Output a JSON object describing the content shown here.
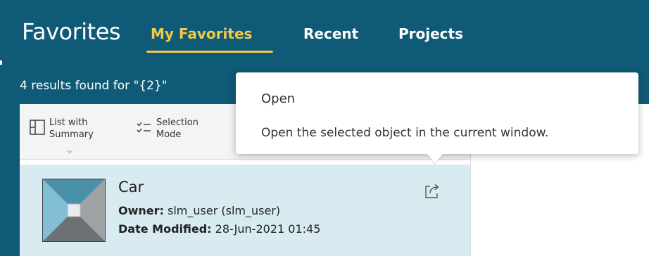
{
  "header": {
    "title": "Favorites",
    "tabs": [
      {
        "label": "My Favorites",
        "active": true
      },
      {
        "label": "Recent",
        "active": false
      },
      {
        "label": "Projects",
        "active": false
      }
    ],
    "accent_color": "#f2c94c",
    "background_color": "#0f5a76"
  },
  "results": {
    "text": "4 results found for \"{2}\""
  },
  "toolbar": {
    "view_mode": {
      "line1": "List with",
      "line2": "Summary",
      "icon": "list-with-summary-icon"
    },
    "selection_mode": {
      "line1": "Selection",
      "line2": "Mode",
      "icon": "selection-mode-icon"
    }
  },
  "items": [
    {
      "title": "Car",
      "owner_label": "Owner:",
      "owner_value": "slm_user (slm_user)",
      "date_label": "Date Modified:",
      "date_value": "28-Jun-2021 01:45",
      "icon": "share-icon"
    }
  ],
  "tooltip": {
    "title": "Open",
    "description": "Open the selected object in the current window."
  }
}
